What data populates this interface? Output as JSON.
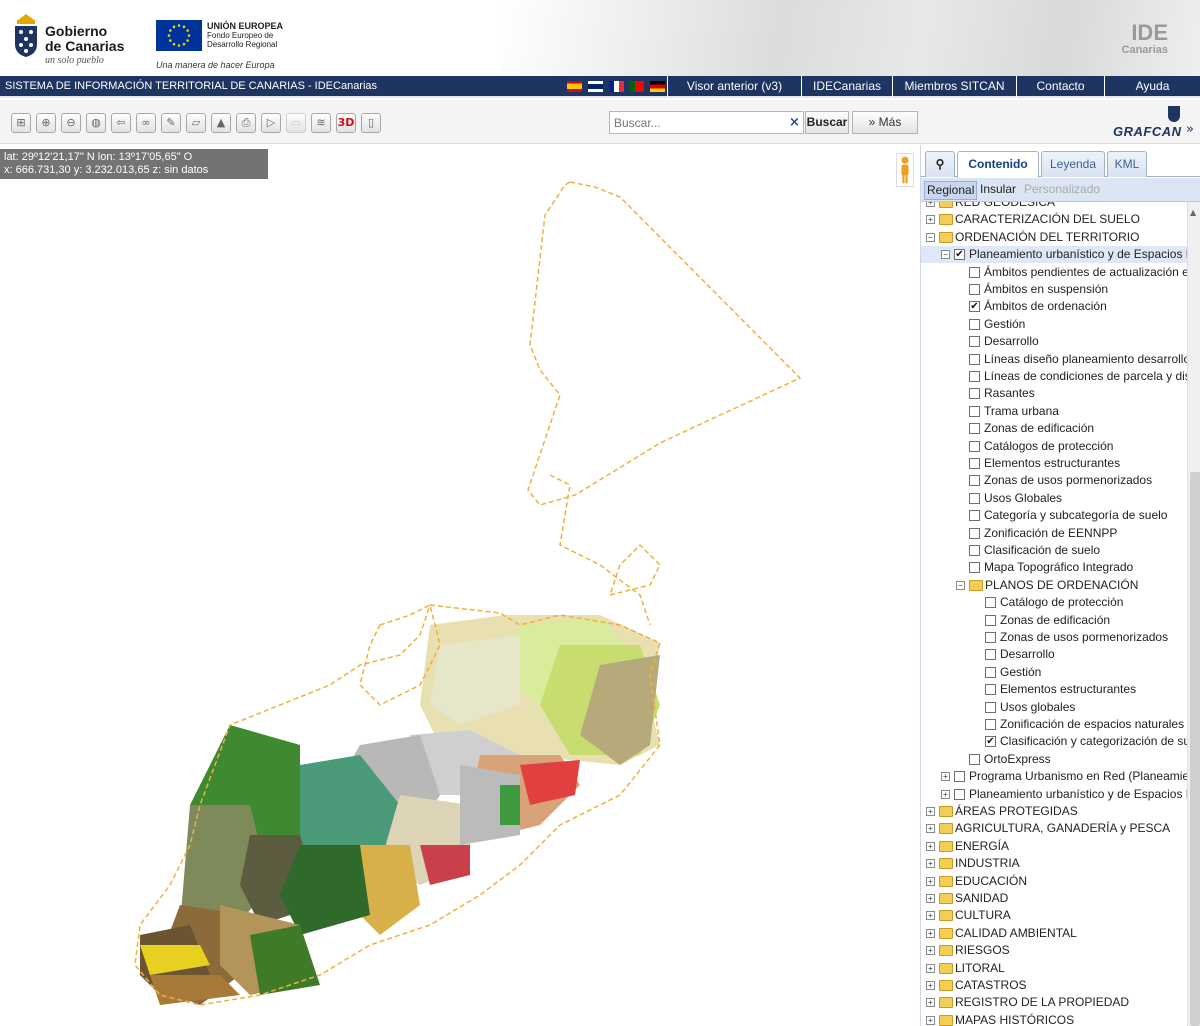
{
  "header": {
    "gob_line1": "Gobierno",
    "gob_line2": "de Canarias",
    "gob_slogan": "un solo pueblo",
    "eu_title": "UNIÓN EUROPEA",
    "eu_line2": "Fondo Europeo de",
    "eu_line3": "Desarrollo Regional",
    "eu_slogan": "Una manera de hacer Europa",
    "ide_line1": "IDE",
    "ide_line2": "Canarias"
  },
  "navbar": {
    "title": "SISTEMA DE INFORMACIÓN TERRITORIAL DE CANARIAS - IDECanarias",
    "links": [
      "Visor anterior (v3)",
      "IDECanarias",
      "Miembros SITCAN",
      "Contacto",
      "Ayuda"
    ]
  },
  "toolbar": {
    "tool_icons": [
      "zoom-box-icon",
      "zoom-in-icon",
      "zoom-out-icon",
      "globe-icon",
      "back-icon",
      "link-icon",
      "measure-distance-icon",
      "measure-area-icon",
      "profile-icon",
      "print-icon",
      "route-icon",
      "lidar-icon",
      "layers-icon",
      "3d-icon",
      "panel-toggle-icon"
    ],
    "tool_3d_label": "3D",
    "search_placeholder": "Buscar...",
    "search_clear": "×",
    "search_button": "Buscar",
    "more_button": "Más",
    "grafcan_label": "GRAFCAN"
  },
  "map": {
    "coords_line1": "lat: 29º12'21,17\" N  lon: 13º17'05,65\" O",
    "coords_line2": "x: 666.731,30  y: 3.232.013,65  z: sin datos"
  },
  "panel": {
    "tabs": [
      "Contenido",
      "Leyenda",
      "KML"
    ],
    "active_tab": "Contenido",
    "subtabs": [
      "Regional",
      "Insular",
      "Personalizado"
    ],
    "tree": [
      {
        "label": "RED GEODÉSICA",
        "level": 0,
        "type": "folder",
        "expanded": false
      },
      {
        "label": "CARACTERIZACIÓN DEL SUELO",
        "level": 0,
        "type": "folder",
        "expanded": false
      },
      {
        "label": "ORDENACIÓN DEL TERRITORIO",
        "level": 0,
        "type": "folder",
        "expanded": true
      },
      {
        "label": "Planeamiento urbanístico y de Espacios N",
        "level": 1,
        "type": "layer",
        "expanded": true,
        "checked": true,
        "selected": true
      },
      {
        "label": "Ámbitos pendientes de actualización en",
        "level": 2,
        "type": "layer",
        "checked": false
      },
      {
        "label": "Ámbitos en suspensión",
        "level": 2,
        "type": "layer",
        "checked": false
      },
      {
        "label": "Ámbitos de ordenación",
        "level": 2,
        "type": "layer",
        "checked": true
      },
      {
        "label": "Gestión",
        "level": 2,
        "type": "layer",
        "checked": false
      },
      {
        "label": "Desarrollo",
        "level": 2,
        "type": "layer",
        "checked": false
      },
      {
        "label": "Líneas diseño planeamiento desarrollo",
        "level": 2,
        "type": "layer",
        "checked": false
      },
      {
        "label": "Líneas de condiciones de parcela y dis",
        "level": 2,
        "type": "layer",
        "checked": false
      },
      {
        "label": "Rasantes",
        "level": 2,
        "type": "layer",
        "checked": false
      },
      {
        "label": "Trama urbana",
        "level": 2,
        "type": "layer",
        "checked": false
      },
      {
        "label": "Zonas de edificación",
        "level": 2,
        "type": "layer",
        "checked": false
      },
      {
        "label": "Catálogos de protección",
        "level": 2,
        "type": "layer",
        "checked": false
      },
      {
        "label": "Elementos estructurantes",
        "level": 2,
        "type": "layer",
        "checked": false
      },
      {
        "label": "Zonas de usos pormenorizados",
        "level": 2,
        "type": "layer",
        "checked": false
      },
      {
        "label": "Usos Globales",
        "level": 2,
        "type": "layer",
        "checked": false
      },
      {
        "label": "Categoría y subcategoría de suelo",
        "level": 2,
        "type": "layer",
        "checked": false
      },
      {
        "label": "Zonificación de EENNPP",
        "level": 2,
        "type": "layer",
        "checked": false
      },
      {
        "label": "Clasificación de suelo",
        "level": 2,
        "type": "layer",
        "checked": false
      },
      {
        "label": "Mapa Topográfico Integrado",
        "level": 2,
        "type": "layer",
        "checked": false
      },
      {
        "label": "PLANOS DE ORDENACIÓN",
        "level": 2,
        "type": "folder",
        "expanded": true
      },
      {
        "label": "Catálogo de protección",
        "level": 3,
        "type": "layer",
        "checked": false
      },
      {
        "label": "Zonas de edificación",
        "level": 3,
        "type": "layer",
        "checked": false
      },
      {
        "label": "Zonas de usos pormenorizados",
        "level": 3,
        "type": "layer",
        "checked": false
      },
      {
        "label": "Desarrollo",
        "level": 3,
        "type": "layer",
        "checked": false
      },
      {
        "label": "Gestión",
        "level": 3,
        "type": "layer",
        "checked": false
      },
      {
        "label": "Elementos estructurantes",
        "level": 3,
        "type": "layer",
        "checked": false
      },
      {
        "label": "Usos globales",
        "level": 3,
        "type": "layer",
        "checked": false
      },
      {
        "label": "Zonificación de espacios naturales p",
        "level": 3,
        "type": "layer",
        "checked": false
      },
      {
        "label": "Clasificación y categorización de su",
        "level": 3,
        "type": "layer",
        "checked": true
      },
      {
        "label": "OrtoExpress",
        "level": 2,
        "type": "layer",
        "checked": false
      },
      {
        "label": "Programa Urbanismo en Red (Planeamien",
        "level": 1,
        "type": "layer",
        "expanded": false,
        "checked": false
      },
      {
        "label": "Planeamiento urbanístico y de Espacios N",
        "level": 1,
        "type": "layer",
        "expanded": false,
        "checked": false
      },
      {
        "label": "ÁREAS PROTEGIDAS",
        "level": 0,
        "type": "folder",
        "expanded": false
      },
      {
        "label": "AGRICULTURA, GANADERÍA y PESCA",
        "level": 0,
        "type": "folder",
        "expanded": false
      },
      {
        "label": "ENERGÍA",
        "level": 0,
        "type": "folder",
        "expanded": false
      },
      {
        "label": "INDUSTRIA",
        "level": 0,
        "type": "folder",
        "expanded": false
      },
      {
        "label": "EDUCACIÓN",
        "level": 0,
        "type": "folder",
        "expanded": false
      },
      {
        "label": "SANIDAD",
        "level": 0,
        "type": "folder",
        "expanded": false
      },
      {
        "label": "CULTURA",
        "level": 0,
        "type": "folder",
        "expanded": false
      },
      {
        "label": "CALIDAD AMBIENTAL",
        "level": 0,
        "type": "folder",
        "expanded": false
      },
      {
        "label": "RIESGOS",
        "level": 0,
        "type": "folder",
        "expanded": false
      },
      {
        "label": "LITORAL",
        "level": 0,
        "type": "folder",
        "expanded": false
      },
      {
        "label": "CATASTROS",
        "level": 0,
        "type": "folder",
        "expanded": false
      },
      {
        "label": "REGISTRO DE LA PROPIEDAD",
        "level": 0,
        "type": "folder",
        "expanded": false
      },
      {
        "label": "MAPAS HISTÓRICOS",
        "level": 0,
        "type": "folder",
        "expanded": false
      }
    ]
  },
  "colors": {
    "navbar": "#1e3461",
    "boundary": "#f0b040",
    "tab_text": "#154287"
  }
}
